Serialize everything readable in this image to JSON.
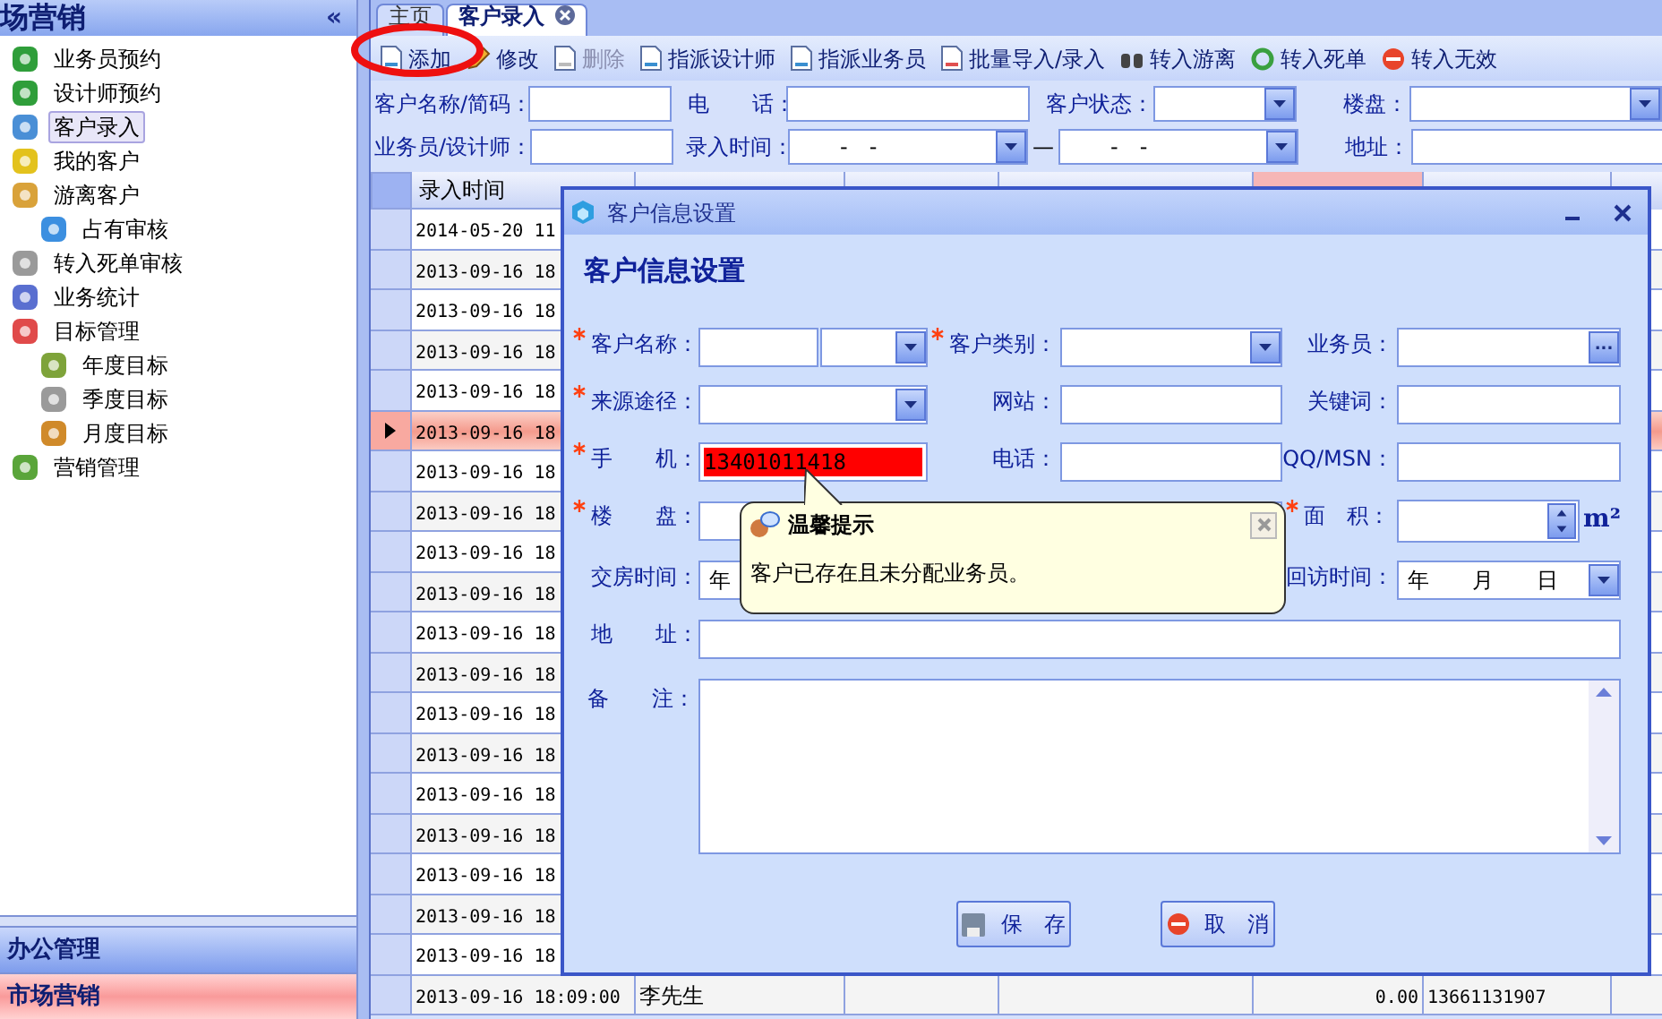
{
  "sidebar": {
    "title": "场营销",
    "collapse": "«",
    "items": [
      {
        "label": "业务员预约",
        "selected": false
      },
      {
        "label": "设计师预约",
        "selected": false
      },
      {
        "label": "客户录入",
        "selected": true
      },
      {
        "label": "我的客户",
        "selected": false
      },
      {
        "label": "游离客户",
        "selected": false,
        "children": [
          {
            "label": "占有审核",
            "selected": false
          }
        ]
      },
      {
        "label": "转入死单审核",
        "selected": false
      },
      {
        "label": "业务统计",
        "selected": false
      },
      {
        "label": "目标管理",
        "selected": false,
        "children": [
          {
            "label": "年度目标",
            "selected": false
          },
          {
            "label": "季度目标",
            "selected": false
          },
          {
            "label": "月度目标",
            "selected": false
          }
        ]
      },
      {
        "label": "营销管理",
        "selected": false
      }
    ],
    "sections": [
      {
        "label": "办公管理",
        "selected": false
      },
      {
        "label": "市场营销",
        "selected": true
      }
    ]
  },
  "tabs": [
    {
      "label": "主页",
      "selected": false,
      "closable": false
    },
    {
      "label": "客户录入",
      "selected": true,
      "closable": true
    }
  ],
  "toolbar": [
    {
      "label": "添加",
      "disabled": false
    },
    {
      "label": "修改",
      "disabled": false
    },
    {
      "label": "删除",
      "disabled": true
    },
    {
      "label": "指派设计师",
      "disabled": false
    },
    {
      "label": "指派业务员",
      "disabled": false
    },
    {
      "label": "批量导入/录入",
      "disabled": false
    },
    {
      "label": "转入游离",
      "disabled": false
    },
    {
      "label": "转入死单",
      "disabled": false
    },
    {
      "label": "转入无效",
      "disabled": false
    }
  ],
  "filters": [
    [
      {
        "kind": "label",
        "text": "客户名称/简码："
      },
      {
        "kind": "text"
      },
      {
        "kind": "label",
        "text": "电　　话："
      },
      {
        "kind": "text"
      },
      {
        "kind": "label",
        "text": "客户状态："
      },
      {
        "kind": "select"
      },
      {
        "kind": "label",
        "text": "楼盘："
      },
      {
        "kind": "select"
      }
    ],
    [
      {
        "kind": "label",
        "text": "业务员/设计师："
      },
      {
        "kind": "text"
      },
      {
        "kind": "label",
        "text": "录入时间："
      },
      {
        "kind": "date",
        "value": "-　-"
      },
      {
        "kind": "sep",
        "text": "—"
      },
      {
        "kind": "date",
        "value": "-　-"
      },
      {
        "kind": "label",
        "text": "地址："
      },
      {
        "kind": "text"
      }
    ]
  ],
  "table": {
    "columns": [
      "录入时间"
    ],
    "rows": [
      {
        "time": "2014-05-20 11",
        "selected": false
      },
      {
        "time": "2013-09-16 18",
        "selected": false
      },
      {
        "time": "2013-09-16 18",
        "selected": false
      },
      {
        "time": "2013-09-16 18",
        "selected": false
      },
      {
        "time": "2013-09-16 18",
        "selected": false
      },
      {
        "time": "2013-09-16 18",
        "selected": true
      },
      {
        "time": "2013-09-16 18",
        "selected": false
      },
      {
        "time": "2013-09-16 18",
        "selected": false
      },
      {
        "time": "2013-09-16 18",
        "selected": false
      },
      {
        "time": "2013-09-16 18",
        "selected": false
      },
      {
        "time": "2013-09-16 18",
        "selected": false
      },
      {
        "time": "2013-09-16 18",
        "selected": false
      },
      {
        "time": "2013-09-16 18",
        "selected": false
      },
      {
        "time": "2013-09-16 18",
        "selected": false
      },
      {
        "time": "2013-09-16 18",
        "selected": false
      },
      {
        "time": "2013-09-16 18",
        "selected": false
      },
      {
        "time": "2013-09-16 18",
        "selected": false
      },
      {
        "time": "2013-09-16 18",
        "selected": false
      },
      {
        "time": "2013-09-16 18",
        "selected": false
      },
      {
        "time": "2013-09-16 18:09:00",
        "name": "李先生",
        "amount": "0.00",
        "phone": "13661131907",
        "selected": false
      }
    ]
  },
  "dialog": {
    "title": "客户信息设置",
    "heading": "客户信息设置",
    "fields": [
      {
        "label": "客户名称：",
        "required": true,
        "kind": "name"
      },
      {
        "label": "客户类别：",
        "required": true,
        "kind": "select"
      },
      {
        "label": "业务员：",
        "required": false,
        "kind": "lookup",
        "button": "..."
      },
      {
        "label": "来源途径：",
        "required": true,
        "kind": "select"
      },
      {
        "label": "网站：",
        "required": false,
        "kind": "text"
      },
      {
        "label": "关键词：",
        "required": false,
        "kind": "text"
      },
      {
        "label": "手　　机：",
        "required": true,
        "kind": "text",
        "value": "13401011418",
        "error": true
      },
      {
        "label": "电话：",
        "required": false,
        "kind": "text"
      },
      {
        "label": "QQ/MSN：",
        "required": false,
        "kind": "text"
      },
      {
        "label": "楼　　盘：",
        "required": true,
        "kind": "select"
      },
      {
        "kind": "select"
      },
      {
        "label": "面　积：",
        "required": true,
        "kind": "spin",
        "unit": "m²"
      },
      {
        "label": "交房时间：",
        "required": false,
        "kind": "date",
        "value": "年"
      },
      {
        "kind": "blank"
      },
      {
        "label": "回访时间：",
        "required": false,
        "kind": "date",
        "value": "年　　月　　日"
      },
      {
        "label": "地　　址：",
        "required": false,
        "kind": "wide"
      },
      {
        "label": "备　　注：",
        "required": false,
        "kind": "textarea"
      }
    ],
    "buttons": [
      {
        "label": "保　存",
        "kind": "save"
      },
      {
        "label": "取　消",
        "kind": "cancel"
      }
    ],
    "tooltip": {
      "title": "温馨提示",
      "message": "客户已存在且未分配业务员。"
    }
  }
}
